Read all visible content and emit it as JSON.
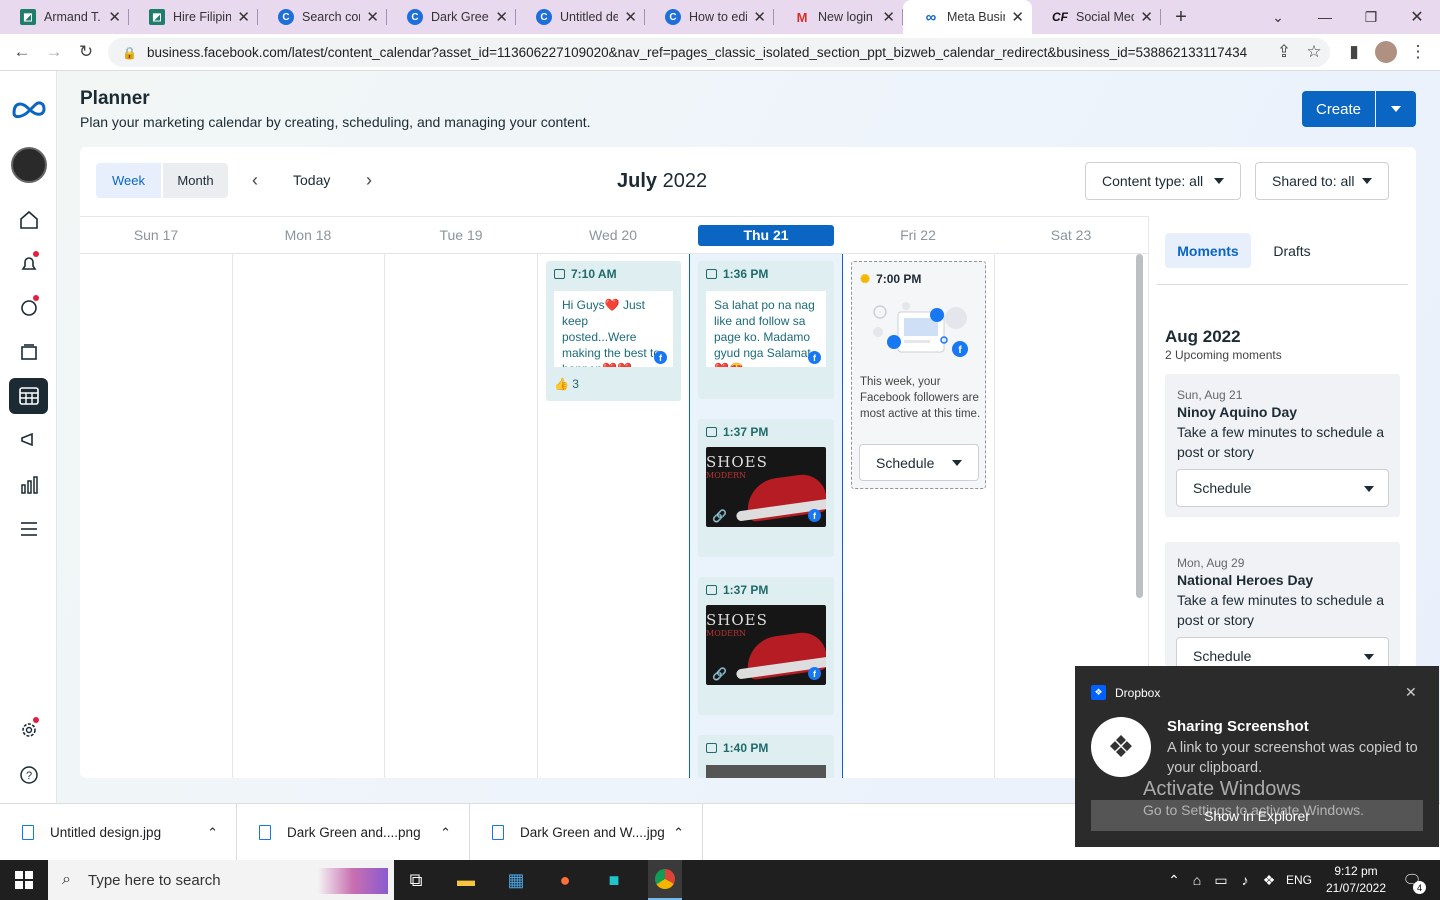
{
  "browser": {
    "tabs": [
      {
        "label": "Armand T. M",
        "color": "#1e7d6b"
      },
      {
        "label": "Hire Filipino",
        "color": "#1e7d6b"
      },
      {
        "label": "Search conte",
        "color": "#1e6fd9"
      },
      {
        "label": "Dark Green a",
        "color": "#1e6fd9"
      },
      {
        "label": "Untitled desi",
        "color": "#1e6fd9"
      },
      {
        "label": "How to edit",
        "color": "#1e6fd9"
      },
      {
        "label": "New login to",
        "color": "#d93025"
      },
      {
        "label": "Meta Busine",
        "color": "#0a66c2"
      },
      {
        "label": "Social Medic",
        "color": "#111111"
      }
    ],
    "url": "business.facebook.com/latest/content_calendar?asset_id=113606227109020&nav_ref=pages_classic_isolated_section_ppt_bizweb_calendar_redirect&business_id=538862133117434"
  },
  "header": {
    "title": "Planner",
    "subtitle": "Plan your marketing calendar by creating, scheduling, and managing your content.",
    "create_label": "Create"
  },
  "toolbar": {
    "week": "Week",
    "month": "Month",
    "today": "Today",
    "month_name": "July",
    "year": "2022",
    "content_type": "Content type: all",
    "shared_to": "Shared to: all"
  },
  "days": [
    "Sun 17",
    "Mon 18",
    "Tue 19",
    "Wed 20",
    "Thu 21",
    "Fri 22",
    "Sat 23"
  ],
  "posts": {
    "wed": {
      "time": "7:10 AM",
      "text": "Hi Guys❤️ Just keep posted...Were making the best to happen❤️❤️",
      "likes": "3"
    },
    "thu1": {
      "time": "1:36 PM",
      "text": "Sa lahat po na nag like and follow sa page ko. Madamo gyud nga Salamat ❤️😍"
    },
    "thu2": {
      "time": "1:37 PM",
      "img_text": "SHOES",
      "img_sub": "MODERN"
    },
    "thu3": {
      "time": "1:37 PM",
      "img_text": "SHOES",
      "img_sub": "MODERN"
    },
    "thu4": {
      "time": "1:40 PM"
    }
  },
  "friday": {
    "time": "7:00 PM",
    "text": "This week, your Facebook followers are most active at this time.",
    "schedule": "Schedule"
  },
  "sidebar": {
    "tab_moments": "Moments",
    "tab_drafts": "Drafts",
    "month": "Aug 2022",
    "upcoming": "2 Upcoming moments",
    "moments": [
      {
        "date": "Sun, Aug 21",
        "name": "Ninoy Aquino Day",
        "desc": "Take a few minutes to schedule a post or story",
        "schedule": "Schedule"
      },
      {
        "date": "Mon, Aug 29",
        "name": "National Heroes Day",
        "desc": "Take a few minutes to schedule a post or story",
        "schedule": "Schedule"
      }
    ]
  },
  "downloads": [
    "Untitled design.jpg",
    "Dark Green and....png",
    "Dark Green and W....jpg"
  ],
  "notification": {
    "app": "Dropbox",
    "title": "Sharing Screenshot",
    "body": "A link to your screenshot was copied to your clipboard.",
    "action": "Show in Explorer"
  },
  "watermark": {
    "line1": "Activate Windows",
    "line2": "Go to Settings to activate Windows."
  },
  "taskbar": {
    "search": "Type here to search",
    "lang": "ENG",
    "time": "9:12 pm",
    "date": "21/07/2022",
    "badge": "4"
  }
}
